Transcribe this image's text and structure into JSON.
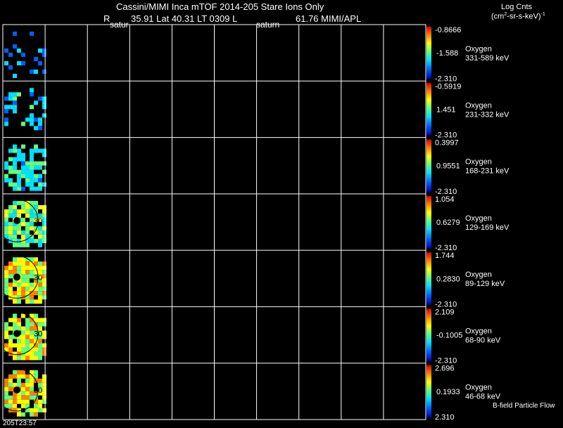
{
  "header": {
    "title_line": "Cassini/MIMI Inca mTOF  2014-205   Stare   Ions Only",
    "r_label": "R",
    "pos_values": "35.91 Lat 40.31 LT 0309 L",
    "l_value": "61.76  MIMI/APL",
    "saturn_label_1": "satur",
    "saturn_label_2": "saturn",
    "log_cnts": "Log Cnts",
    "units_main": "(cm",
    "units_sup": "2",
    "units_rest": "-sr-s-keV)",
    "units_sup2": "-1"
  },
  "footer": {
    "timestamp": "205T23:57",
    "bfield_label": "B-field Particle Flow"
  },
  "chart_data": {
    "type": "heatmap",
    "title": "Cassini/MIMI Inca mTOF  2014-205   Stare   Ions Only",
    "grid_columns": 10,
    "grid": true,
    "colorbar_label": "Log Cnts (cm2-sr-s-keV)-1",
    "ring_label": "30",
    "panels": [
      {
        "species": "Oxygen",
        "energy": "331-589 keV",
        "cb_max": "-0.8666",
        "cb_mid": "-1.588",
        "cb_min": "-2.310"
      },
      {
        "species": "Oxygen",
        "energy": "231-332 keV",
        "cb_max": "-0.5919",
        "cb_mid": "1.451",
        "cb_min": "-2.310"
      },
      {
        "species": "Oxygen",
        "energy": "168-231 keV",
        "cb_max": "0.3997",
        "cb_mid": "0.9551",
        "cb_min": "-2.310"
      },
      {
        "species": "Oxygen",
        "energy": "129-169 keV",
        "cb_max": "1.054",
        "cb_mid": "0.6279",
        "cb_min": "-2.310"
      },
      {
        "species": "Oxygen",
        "energy": "89-129 keV",
        "cb_max": "1.744",
        "cb_mid": "0.2830",
        "cb_min": "-2.310"
      },
      {
        "species": "Oxygen",
        "energy": "68-90 keV",
        "cb_max": "2.109",
        "cb_mid": "-0.1005",
        "cb_min": "-2.310"
      },
      {
        "species": "Oxygen",
        "energy": "46-68 keV",
        "cb_max": "2.696",
        "cb_mid": "0.1933",
        "cb_min": "2.310"
      }
    ]
  }
}
